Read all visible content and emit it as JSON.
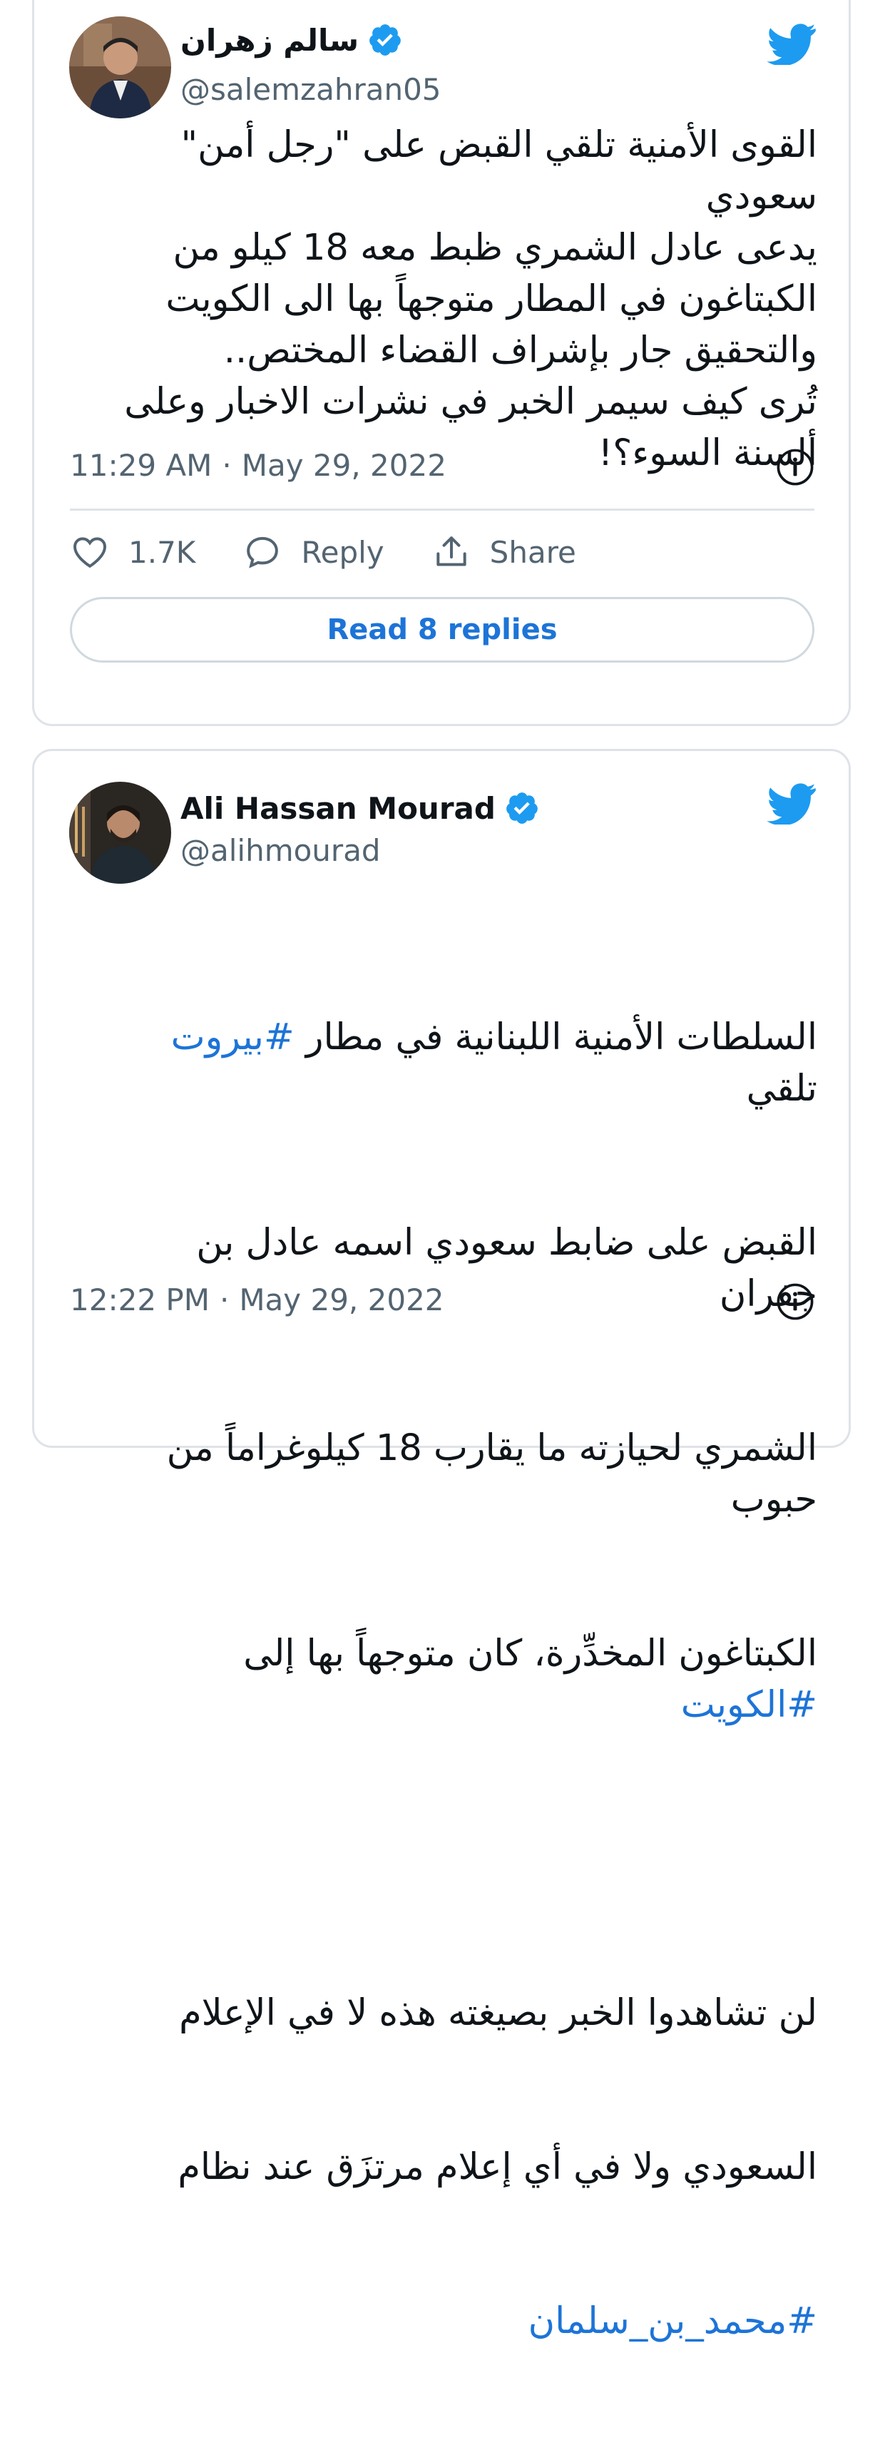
{
  "tweets": [
    {
      "author_name": "سالم زهران",
      "handle": "@salemzahran05",
      "body": "القوى الأمنية تلقي القبض على \"رجل أمن\" سعودي\nيدعى عادل الشمري ظبط معه 18 كيلو من\nالكبتاغون في المطار متوجهاً بها الى الكويت\nوالتحقيق جار بإشراف القضاء المختص..\nتُرى كيف سيمر الخبر في نشرات الاخبار وعلى\nألسنة السوء؟!",
      "time": "11:29 AM",
      "separator": "·",
      "date": "May 29, 2022",
      "likes": "1.7K",
      "reply_label": "Reply",
      "share_label": "Share",
      "read_replies_label": "Read 8 replies"
    },
    {
      "author_name": "Ali Hassan Mourad",
      "handle": "@alihmourad",
      "body_lines": [
        [
          "السلطات الأمنية اللبنانية في مطار ",
          "#بيروت",
          " تلقي"
        ],
        [
          "القبض على ضابط سعودي اسمه عادل بن جفران"
        ],
        [
          "الشمري لحيازته ما يقارب 18 كيلوغراماً من حبوب"
        ],
        [
          "الكبتاغون المخدِّرة، كان متوجهاً بها إلى ",
          "#الكويت",
          ""
        ],
        [
          ""
        ],
        [
          "لن تشاهدوا الخبر بصيغته هذه لا في الإعلام"
        ],
        [
          "السعودي ولا في أي إعلام مرتزَق عند نظام"
        ],
        [
          "",
          "#محمد_بن_سلمان",
          ""
        ]
      ],
      "time": "12:22 PM",
      "separator": "·",
      "date": "May 29, 2022"
    }
  ],
  "colors": {
    "link": "#1d74d7",
    "twitter_blue": "#1d9bf0",
    "muted": "#536471",
    "border": "#dfe3e8"
  },
  "icons": {
    "brand": "twitter-bird-icon",
    "verified": "verified-badge-icon",
    "info": "info-icon",
    "like": "heart-icon",
    "reply": "speech-bubble-icon",
    "share": "share-icon"
  }
}
